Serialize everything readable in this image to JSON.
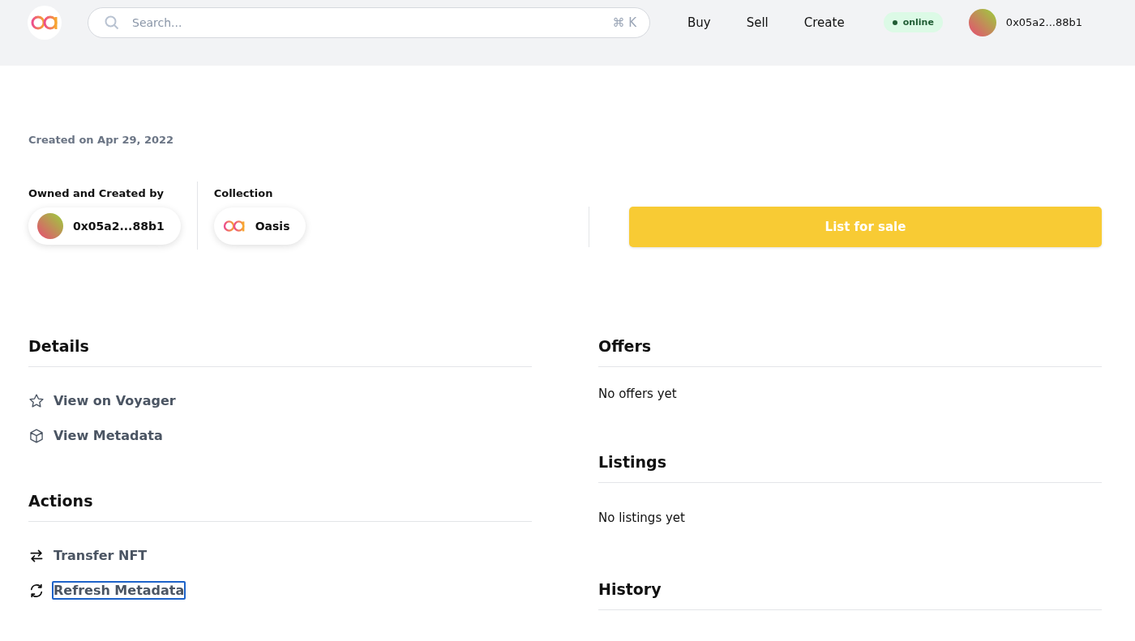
{
  "header": {
    "search": {
      "placeholder": "Search...",
      "shortcut": "⌘ K"
    },
    "nav": [
      "Buy",
      "Sell",
      "Create"
    ],
    "status": "online",
    "account": "0x05a2...88b1"
  },
  "created": "Created on Apr 29, 2022",
  "owner": {
    "label": "Owned and Created by",
    "address": "0x05a2...88b1"
  },
  "collection": {
    "label": "Collection",
    "name": "Oasis"
  },
  "list_button": "List for sale",
  "details": {
    "title": "Details",
    "links": [
      {
        "label": "View on Voyager",
        "focused": false
      },
      {
        "label": "View Metadata",
        "focused": false
      }
    ]
  },
  "actions": {
    "title": "Actions",
    "links": [
      {
        "label": "Transfer NFT",
        "focused": false
      },
      {
        "label": "Refresh Metadata",
        "focused": true
      }
    ]
  },
  "offers": {
    "title": "Offers",
    "empty": "No offers yet"
  },
  "listings": {
    "title": "Listings",
    "empty": "No listings yet"
  },
  "history": {
    "title": "History"
  }
}
